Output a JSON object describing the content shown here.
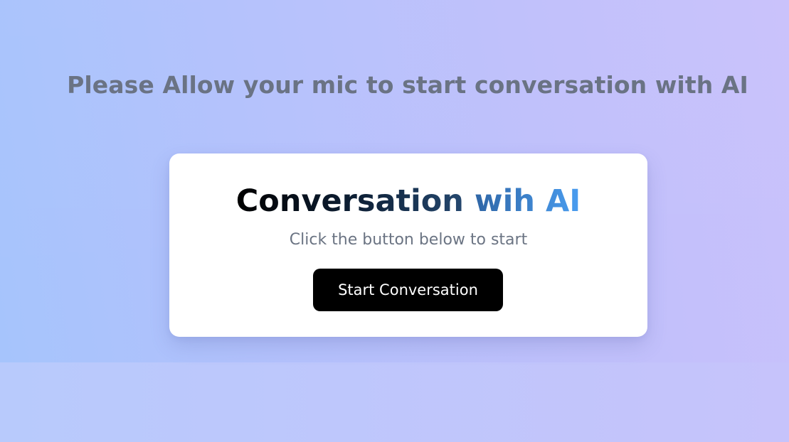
{
  "notice": {
    "text": "Please Allow your mic to start conversation with AI"
  },
  "card": {
    "title_part1": "Conversation",
    "title_part2": "wih AI",
    "subtitle": "Click the button below to start",
    "button_label": "Start Conversation"
  },
  "colors": {
    "background_start": "#a6c4fc",
    "background_end": "#c9c1fb",
    "notice_text": "#6a7384",
    "title_gradient_dark": "#000000",
    "title_gradient_blue": "#4a9df0",
    "subtitle_text": "#6b7483",
    "button_bg": "#000000",
    "button_text": "#ffffff",
    "card_bg": "#ffffff"
  }
}
